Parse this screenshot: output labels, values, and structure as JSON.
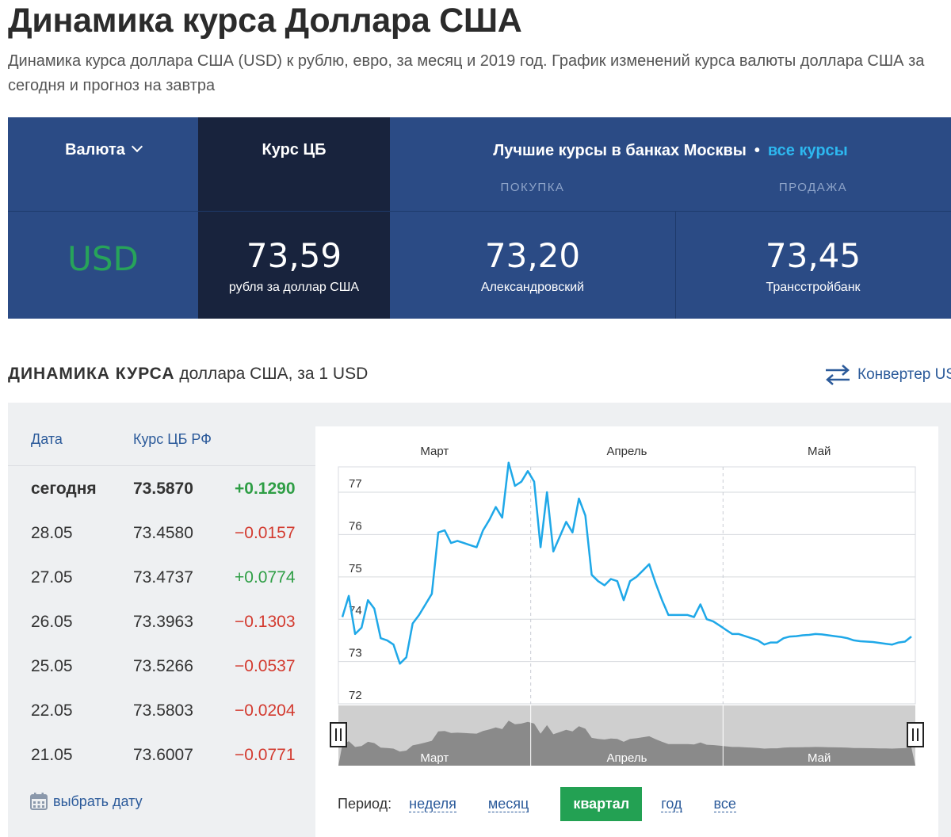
{
  "page": {
    "title": "Динамика курса Доллара США",
    "description": "Динамика курса доллара США (USD) к рублю, евро, за месяц и 2019 год. График изменений курса валюты доллара США за сегодня и прогноз на завтра"
  },
  "rates_panel": {
    "currency_label": "Валюта",
    "cb_label": "Курс ЦБ",
    "best_label": "Лучшие курсы в банках Москвы",
    "all_link": "все курсы",
    "buy_label": "ПОКУПКА",
    "sell_label": "ПРОДАЖА",
    "currency_code": "USD",
    "cb_rate": "73,59",
    "cb_caption": "рубля за доллар США",
    "buy_rate": "73,20",
    "buy_bank": "Александровский",
    "sell_rate": "73,45",
    "sell_bank": "Трансстройбанк",
    "colors": {
      "panel": "#2b4b85",
      "dark": "#18233d",
      "usd": "#27a35a",
      "link": "#2db8f0"
    }
  },
  "section": {
    "title_bold": "ДИНАМИКА КУРСА",
    "title_rest": " доллара США, за 1 USD",
    "converter": "Конвертер US"
  },
  "table": {
    "col_date": "Дата",
    "col_rate": "Курс ЦБ РФ",
    "rows": [
      {
        "date": "сегодня",
        "rate": "73.5870",
        "change": "+0.1290",
        "dir": "pos"
      },
      {
        "date": "28.05",
        "rate": "73.4580",
        "change": "−0.0157",
        "dir": "neg"
      },
      {
        "date": "27.05",
        "rate": "73.4737",
        "change": "+0.0774",
        "dir": "pos"
      },
      {
        "date": "26.05",
        "rate": "73.3963",
        "change": "−0.1303",
        "dir": "neg"
      },
      {
        "date": "25.05",
        "rate": "73.5266",
        "change": "−0.0537",
        "dir": "neg"
      },
      {
        "date": "22.05",
        "rate": "73.5803",
        "change": "−0.0204",
        "dir": "neg"
      },
      {
        "date": "21.05",
        "rate": "73.6007",
        "change": "−0.0771",
        "dir": "neg"
      }
    ],
    "pick_date": "выбрать дату"
  },
  "period": {
    "label": "Период:",
    "options": [
      "неделя",
      "месяц",
      "квартал",
      "год",
      "все"
    ],
    "active": "квартал"
  },
  "chart_data": {
    "type": "line",
    "months": [
      "Март",
      "Апрель",
      "Май"
    ],
    "y_ticks": [
      77,
      76,
      75,
      74,
      73,
      72
    ],
    "ylim": [
      72,
      77.6
    ],
    "grid": true,
    "line_color": "#1fa8e8",
    "x": [
      0,
      1,
      2,
      3,
      4,
      5,
      6,
      7,
      8,
      9,
      10,
      11,
      12,
      13,
      14,
      15,
      16,
      17,
      18,
      19,
      20,
      21,
      22,
      23,
      24,
      25,
      26,
      27,
      28,
      29,
      30,
      31,
      32,
      33,
      34,
      35,
      36,
      37,
      38,
      39,
      40,
      41,
      42,
      43,
      44,
      45,
      46,
      47,
      48,
      49,
      50,
      51,
      52,
      53,
      54,
      55,
      56,
      57,
      58,
      59,
      60,
      61,
      62,
      63,
      64,
      65,
      66,
      67,
      68,
      69,
      70,
      71,
      72,
      73,
      74,
      75,
      76,
      77,
      78,
      79,
      80,
      81,
      82,
      83,
      84,
      85,
      86,
      87,
      88,
      89
    ],
    "values": [
      74.05,
      74.55,
      73.65,
      73.8,
      74.45,
      74.25,
      73.55,
      73.5,
      73.4,
      72.95,
      73.1,
      73.9,
      74.1,
      74.35,
      74.6,
      76.05,
      76.1,
      75.8,
      75.85,
      75.8,
      75.75,
      75.7,
      76.1,
      76.35,
      76.65,
      76.4,
      77.7,
      77.15,
      77.25,
      77.5,
      77.25,
      75.7,
      77.0,
      75.6,
      75.95,
      76.3,
      76.05,
      76.85,
      76.45,
      75.05,
      74.9,
      74.8,
      74.95,
      74.9,
      74.45,
      74.9,
      75.0,
      75.15,
      75.3,
      74.85,
      74.45,
      74.1,
      74.1,
      74.1,
      74.1,
      74.05,
      74.35,
      74.0,
      73.95,
      73.85,
      73.75,
      73.65,
      73.65,
      73.6,
      73.55,
      73.5,
      73.4,
      73.45,
      73.45,
      73.55,
      73.59,
      73.6,
      73.62,
      73.63,
      73.65,
      73.64,
      73.62,
      73.6,
      73.58,
      73.55,
      73.5,
      73.48,
      73.47,
      73.46,
      73.44,
      73.42,
      73.4,
      73.45,
      73.47,
      73.59
    ]
  }
}
